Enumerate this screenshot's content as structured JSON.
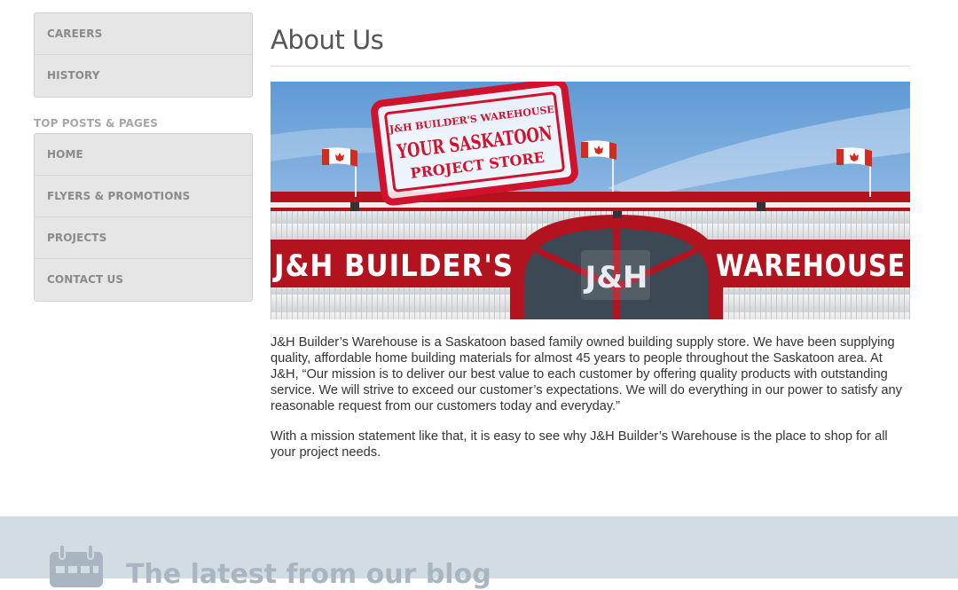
{
  "sidebar": {
    "top_menu": [
      "CAREERS",
      "HISTORY"
    ],
    "widget_title": "TOP POSTS & PAGES",
    "top_posts": [
      "HOME",
      "FLYERS & PROMOTIONS",
      "PROJECTS",
      "CONTACT US"
    ]
  },
  "main": {
    "title": "About Us",
    "hero": {
      "stamp_line1": "J&H BUILDER'S WAREHOUSE",
      "stamp_line2": "YOUR SASKATOON",
      "stamp_line3": "PROJECT STORE",
      "sign_left": "J&H BUILDER'S",
      "sign_right": "WAREHOUSE",
      "sign_logo": "J&H"
    },
    "paragraph1": "J&H Builder’s Warehouse is a Saskatoon based family owned building supply store. We have been supplying quality, affordable home building materials for almost 45 years to people throughout the Saskatoon area. At J&H, “Our mission is to deliver our best value to each customer by offering quality products with outstanding service. We will strive to exceed our customer’s expectations. We will do everything in our power to satisfy any reasonable request from our customers today and everyday.”",
    "paragraph2": "With a mission statement like that, it is easy to see why J&H Builder’s Warehouse is the place to shop for all your project needs."
  },
  "footer": {
    "blog_heading": "The latest from our blog",
    "icon": "calendar-icon"
  },
  "colors": {
    "brand_red": "#c8102e",
    "footer_bg": "#d2dce3",
    "menu_bg": "#e6e6e6"
  }
}
